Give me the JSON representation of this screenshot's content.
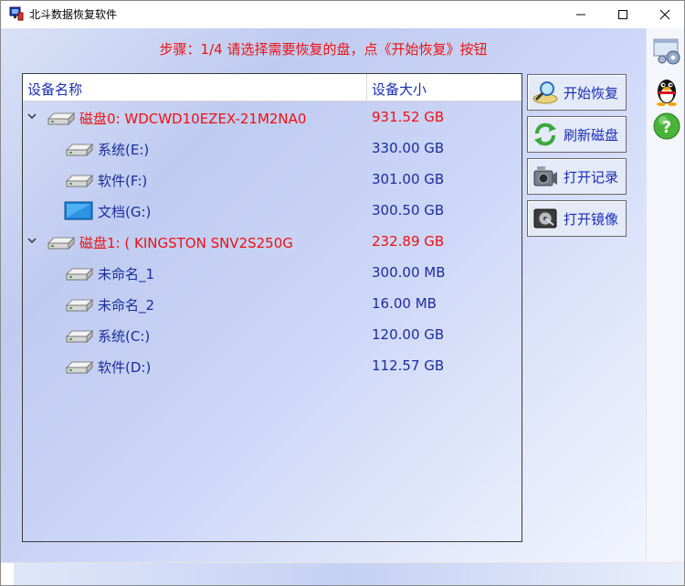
{
  "window": {
    "title": "北斗数据恢复软件",
    "minimize_icon": "minimize-icon",
    "maximize_icon": "maximize-icon",
    "close_icon": "close-icon"
  },
  "step_text": "步骤：1/4 请选择需要恢复的盘，点《开始恢复》按钮",
  "tree": {
    "columns": {
      "name": "设备名称",
      "size": "设备大小"
    },
    "rows": [
      {
        "type": "disk",
        "name": "磁盘0: WDCWD10EZEX-21M2NA0",
        "size": "931.52 GB",
        "icon": "hard-drive-icon"
      },
      {
        "type": "partition",
        "name": "系统(E:)",
        "size": "330.00 GB",
        "icon": "drive-icon"
      },
      {
        "type": "partition",
        "name": "软件(F:)",
        "size": "301.00 GB",
        "icon": "drive-icon"
      },
      {
        "type": "partition",
        "name": "文档(G:)",
        "size": "300.50 GB",
        "icon": "monitor-drive-icon"
      },
      {
        "type": "disk",
        "name": "磁盘1: ( KINGSTON SNV2S250G",
        "size": "232.89 GB",
        "icon": "hard-drive-icon"
      },
      {
        "type": "partition",
        "name": "未命名_1",
        "size": "300.00 MB",
        "icon": "drive-icon"
      },
      {
        "type": "partition",
        "name": "未命名_2",
        "size": "16.00 MB",
        "icon": "drive-icon"
      },
      {
        "type": "partition",
        "name": "系统(C:)",
        "size": "120.00 GB",
        "icon": "drive-icon"
      },
      {
        "type": "partition",
        "name": "软件(D:)",
        "size": "112.57 GB",
        "icon": "drive-icon"
      }
    ]
  },
  "buttons": {
    "start": "开始恢复",
    "refresh": "刷新磁盘",
    "open_record": "打开记录",
    "open_image": "打开镜像"
  },
  "sidebar": {
    "settings_icon": "settings-icon",
    "qq_icon": "qq-penguin-icon",
    "help_icon": "help-icon"
  },
  "colors": {
    "accent_blue": "#1a2eb5",
    "disk_red": "#ee1111"
  }
}
